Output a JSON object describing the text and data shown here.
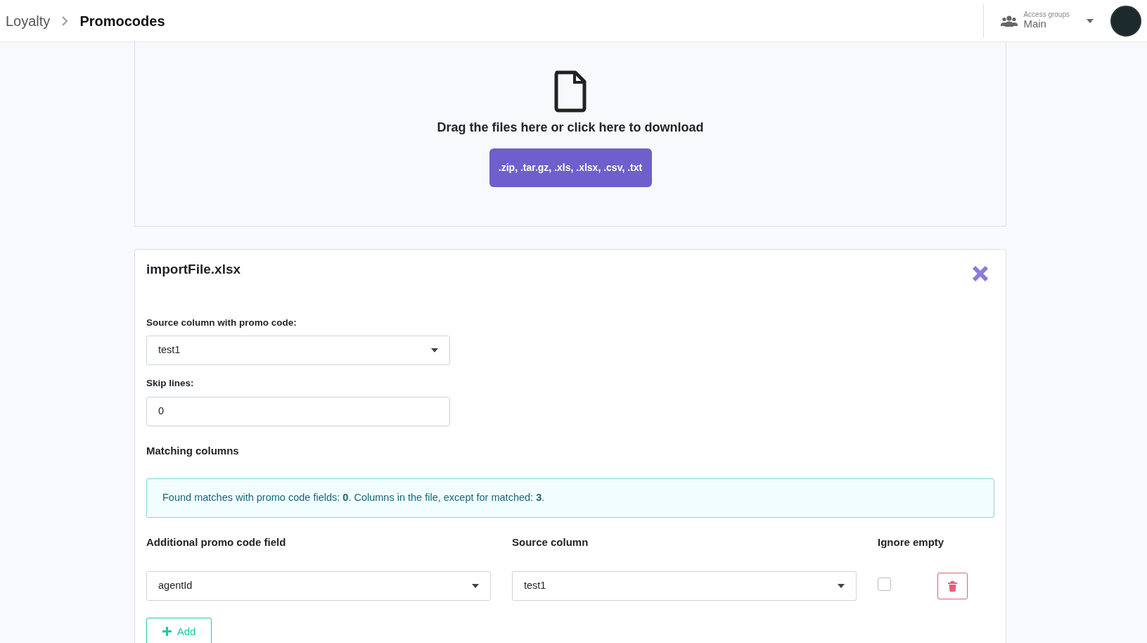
{
  "breadcrumb": [
    {
      "label": "Loyalty",
      "selected": false
    },
    {
      "label": "Promocodes",
      "selected": true
    }
  ],
  "access_groups": {
    "label": "Access groups",
    "value": "Main"
  },
  "dropzone": {
    "text": "Drag the files here or click here to download",
    "button": ".zip, .tar.gz, .xls, .xlsx, .csv, .txt"
  },
  "file_card": {
    "title": "importFile.xlsx",
    "source_column": {
      "label": "Source column with promo code:",
      "value": "test1"
    },
    "skip_lines": {
      "label": "Skip lines:",
      "value": "0"
    },
    "matching_title": "Matching columns",
    "info": "Found matches with promo code fields: **0**. Columns in the file, except for matched: **3**.",
    "columns": [
      "Additional promo code field",
      "Source column",
      "Ignore empty"
    ],
    "rows": [
      {
        "field": "agentId",
        "source": "test1",
        "ignore_empty": false
      }
    ],
    "add_button": "Add"
  }
}
